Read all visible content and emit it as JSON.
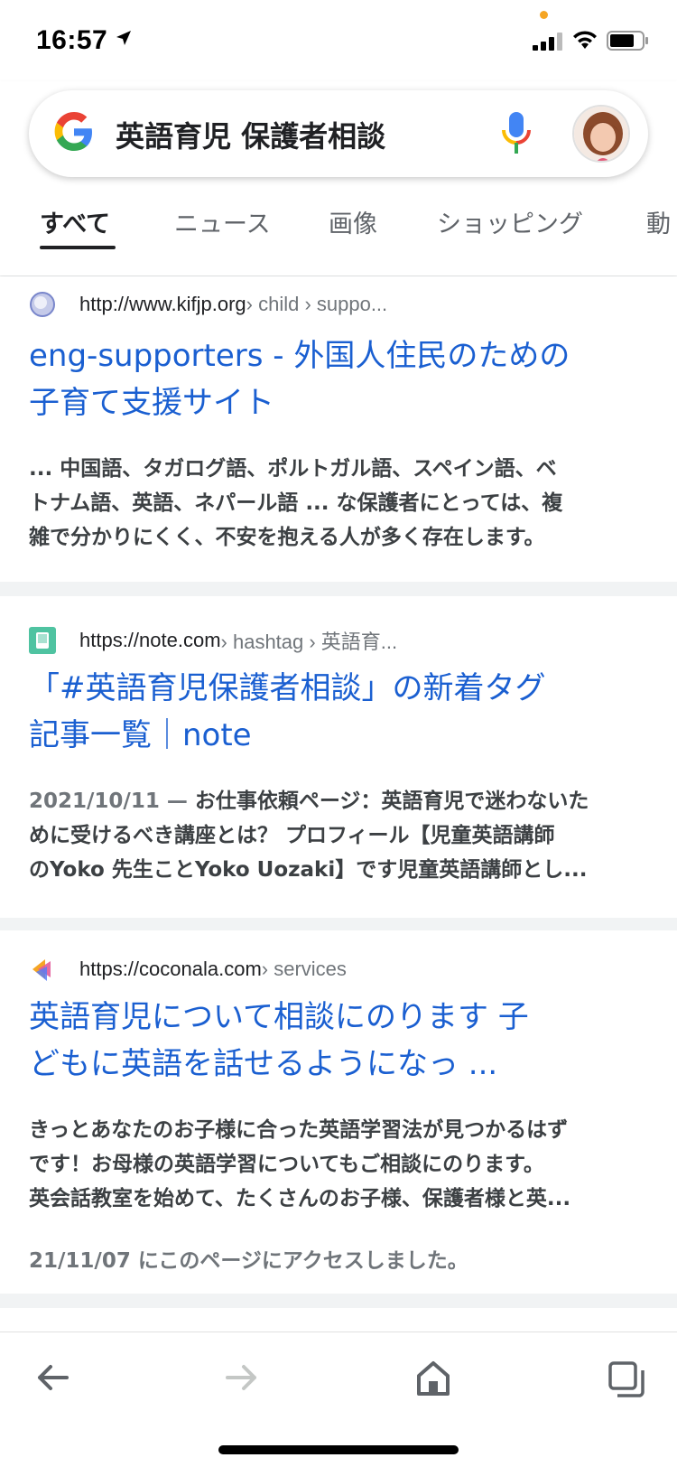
{
  "status_bar": {
    "time": "16:57",
    "accent_dot_color": "#f5a524"
  },
  "search": {
    "query": "英語育児 保護者相談",
    "icons": [
      "google-logo",
      "mic-icon",
      "avatar"
    ]
  },
  "tabs": [
    {
      "label": "すべて",
      "active": true
    },
    {
      "label": "ニュース",
      "active": false
    },
    {
      "label": "画像",
      "active": false
    },
    {
      "label": "ショッピング",
      "active": false
    },
    {
      "label": "動",
      "active": false
    }
  ],
  "results": [
    {
      "favicon": "globe-icon",
      "url_main": "http://www.kifjp.org",
      "url_rest": " › child › suppo...",
      "title_line1": "eng-supporters - 外国人住民のための",
      "title_line2": "子育て支援サイト",
      "snippet_lines": [
        "... 中国語、タガログ語、ポルトガル語、スペイン語、ベ",
        "トナム語、英語、ネパール語 ... な保護者にとっては、複",
        "雑で分かりにくく、不安を抱える人が多く存在します。"
      ]
    },
    {
      "favicon": "note-icon",
      "url_main": "https://note.com",
      "url_rest": " › hashtag › 英語育...",
      "title_line1": "「#英語育児保護者相談」の新着タグ",
      "title_line2": "記事一覧｜note",
      "date": "2021/10/11 — ",
      "snippet_lines": [
        "お仕事依頼ページ：英語育児で迷わないた",
        "めに受けるべき講座とは？ プロフィール【児童英語講師",
        "のYoko 先生ことYoko Uozaki】です児童英語講師とし..."
      ]
    },
    {
      "favicon": "coconala-icon",
      "url_main": "https://coconala.com",
      "url_rest": " › services",
      "title_line1": "英語育児について相談にのります 子",
      "title_line2": "どもに英語を話せるようになっ ...",
      "snippet_lines": [
        "きっとあなたのお子様に合った英語学習法が見つかるはず",
        "です！お母様の英語学習についてもご相談にのります。",
        "英会話教室を始めて、たくさんのお子様、保護者様と英..."
      ],
      "visited": "21/11/07 にこのページにアクセスしました。"
    }
  ],
  "colors": {
    "link": "#1a5fd1",
    "snippet": "#3c4043",
    "url_gray": "#70757a"
  }
}
